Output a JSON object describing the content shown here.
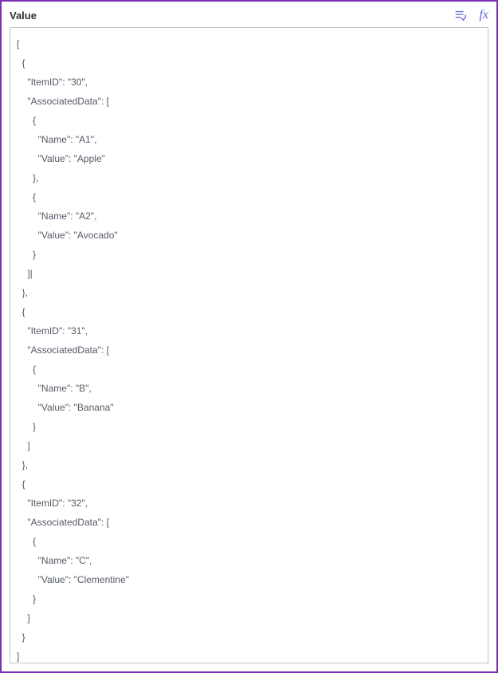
{
  "field": {
    "label": "Value"
  },
  "toolbar": {
    "refresh_icon_name": "refresh-data-icon",
    "fx_label": "fx"
  },
  "code": {
    "lines": [
      "[",
      "  {",
      "    \"ItemID\": \"30\",",
      "    \"AssociatedData\": [",
      "      {",
      "        \"Name\": \"A1\",",
      "        \"Value\": \"Apple\"",
      "      },",
      "      {",
      "        \"Name\": \"A2\",",
      "        \"Value\": \"Avocado\"",
      "      }",
      "    ]|",
      "  },",
      "  {",
      "    \"ItemID\": \"31\",",
      "    \"AssociatedData\": [",
      "      {",
      "        \"Name\": \"B\",",
      "        \"Value\": \"Banana\"",
      "      }",
      "    ]",
      "  },",
      "  {",
      "    \"ItemID\": \"32\",",
      "    \"AssociatedData\": [",
      "      {",
      "        \"Name\": \"C\",",
      "        \"Value\": \"Clementine\"",
      "      }",
      "    ]",
      "  }",
      "]"
    ]
  }
}
